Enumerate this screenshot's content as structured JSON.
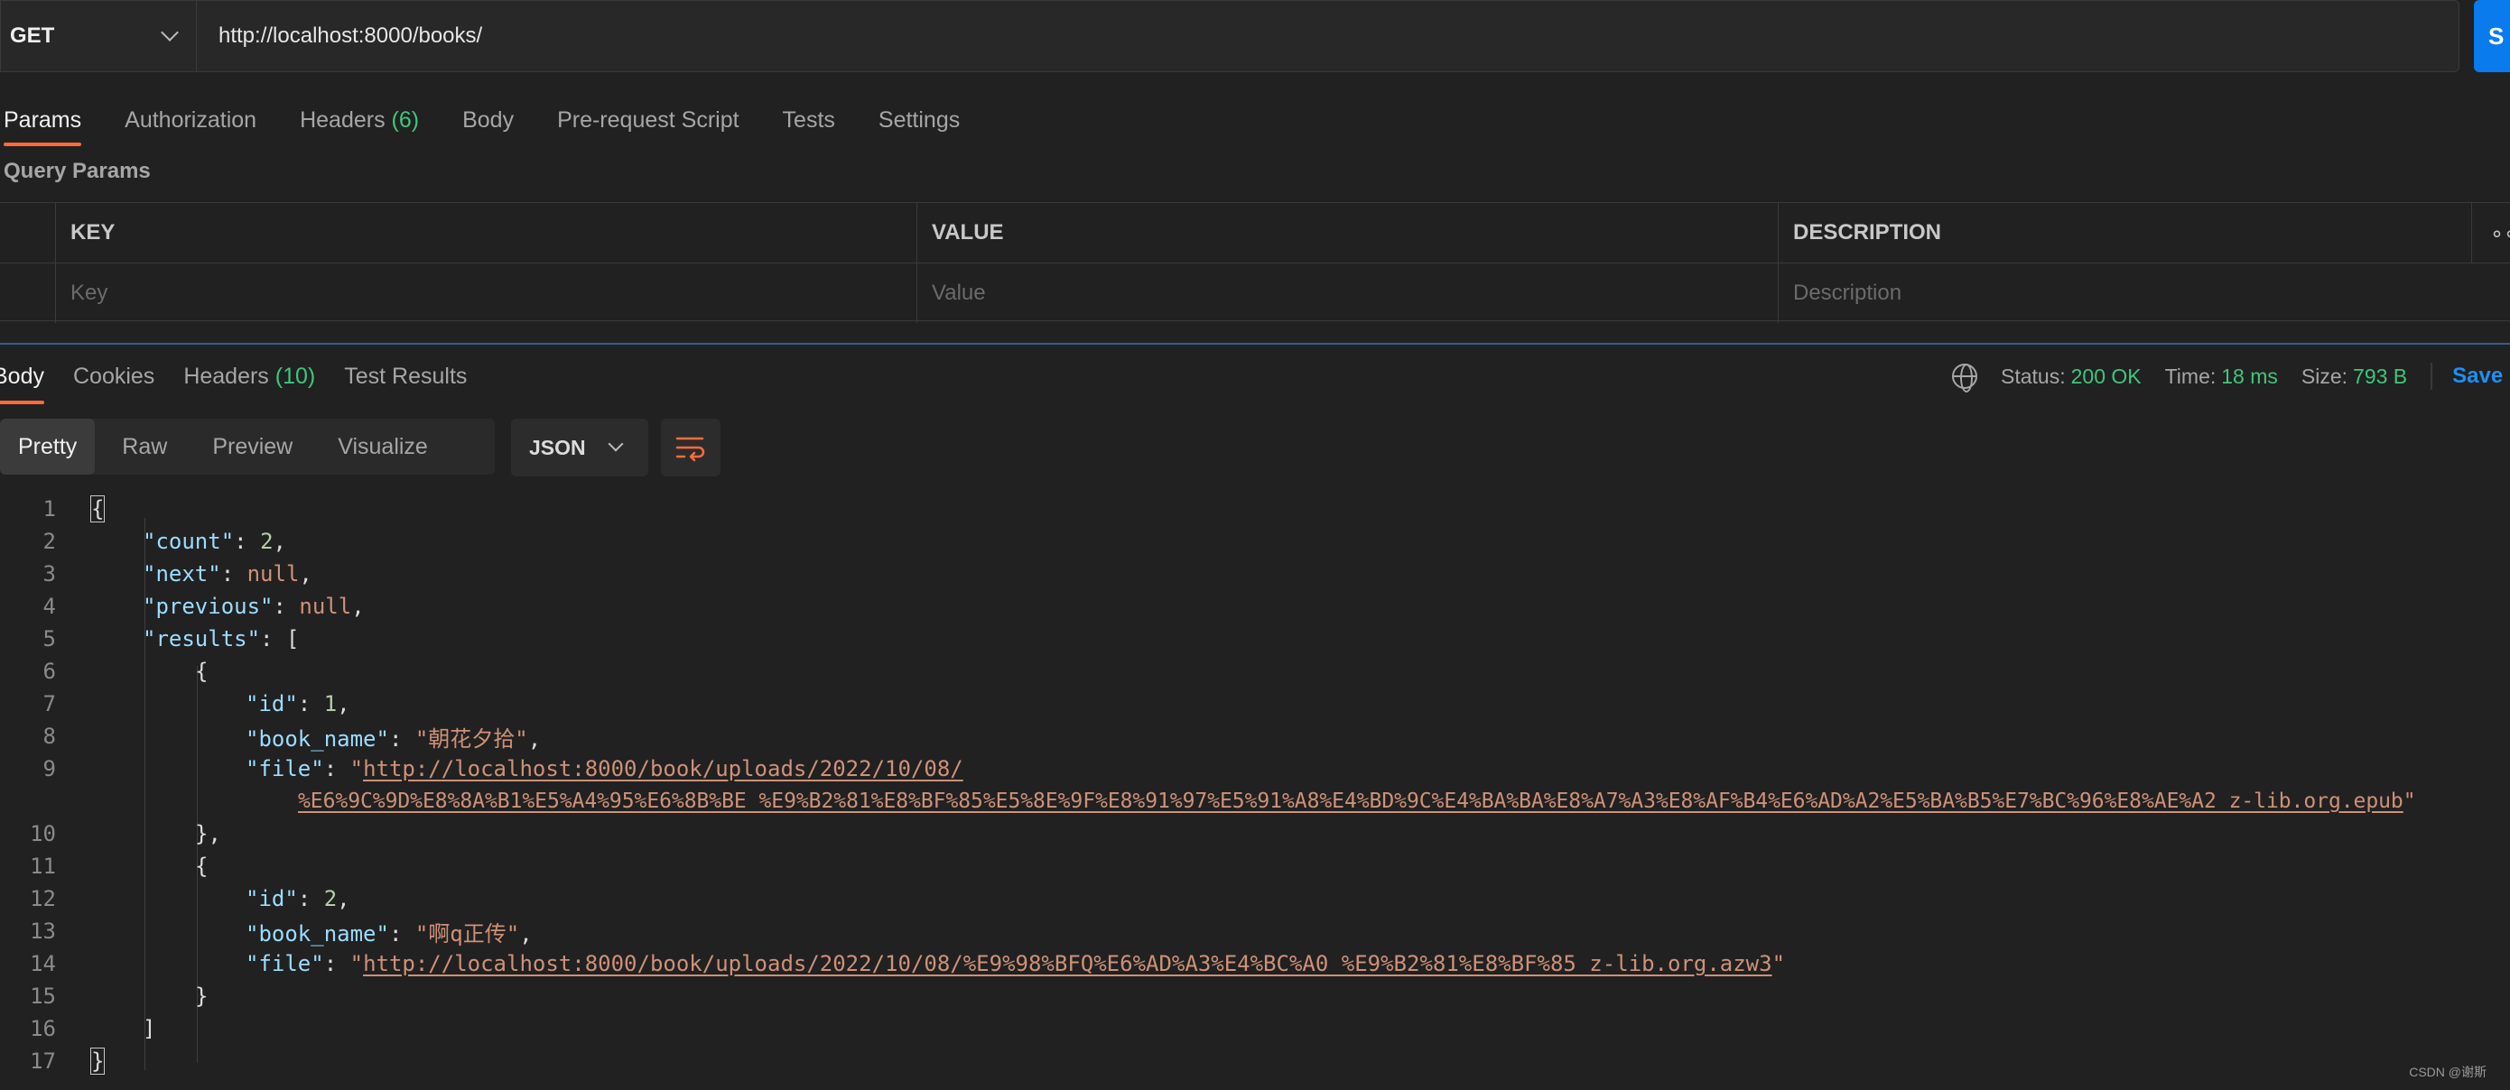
{
  "request": {
    "method": "GET",
    "url": "http://localhost:8000/books/",
    "send_label": "S"
  },
  "request_tabs": {
    "params": "Params",
    "authorization": "Authorization",
    "headers": "Headers",
    "headers_count": "(6)",
    "body": "Body",
    "pre_request": "Pre-request Script",
    "tests": "Tests",
    "settings": "Settings"
  },
  "query_params": {
    "title": "Query Params",
    "columns": [
      "KEY",
      "VALUE",
      "DESCRIPTION"
    ],
    "placeholders": [
      "Key",
      "Value",
      "Description"
    ],
    "more": "∘∘"
  },
  "response_tabs": {
    "body": "Body",
    "cookies": "Cookies",
    "headers": "Headers",
    "headers_count": "(10)",
    "test_results": "Test Results"
  },
  "status": {
    "status_label": "Status:",
    "status_value": "200 OK",
    "time_label": "Time:",
    "time_value": "18 ms",
    "size_label": "Size:",
    "size_value": "793 B",
    "save_label": "Save"
  },
  "view": {
    "modes": [
      "Pretty",
      "Raw",
      "Preview",
      "Visualize"
    ],
    "format": "JSON"
  },
  "code": {
    "line_numbers": [
      "1",
      "2",
      "3",
      "4",
      "5",
      "6",
      "7",
      "8",
      "9",
      "10",
      "11",
      "12",
      "13",
      "14",
      "15",
      "16",
      "17"
    ],
    "count_key": "\"count\"",
    "count_val": "2",
    "next_key": "\"next\"",
    "previous_key": "\"previous\"",
    "null": "null",
    "results_key": "\"results\"",
    "id_key": "\"id\"",
    "book_name_key": "\"book_name\"",
    "file_key": "\"file\"",
    "r1_id": "1",
    "r1_name": "\"朝花夕拾\"",
    "r1_file_a": "http://localhost:8000/book/uploads/2022/10/08/",
    "r1_file_b": "%E6%9C%9D%E8%8A%B1%E5%A4%95%E6%8B%BE_%E9%B2%81%E8%BF%85%E5%8E%9F%E8%91%97%E5%91%A8%E4%BD%9C%E4%BA%BA%E8%A7%A3%E8%AF%B4%E6%AD%A2%E5%BA%B5%E7%BC%96%E8%AE%A2_z-lib.org.epub",
    "r2_id": "2",
    "r2_name": "\"啊q正传\"",
    "r2_file": "http://localhost:8000/book/uploads/2022/10/08/%E9%98%BFQ%E6%AD%A3%E4%BC%A0_%E9%B2%81%E8%BF%85_z-lib.org.azw3"
  },
  "watermark": "CSDN @谢斯"
}
